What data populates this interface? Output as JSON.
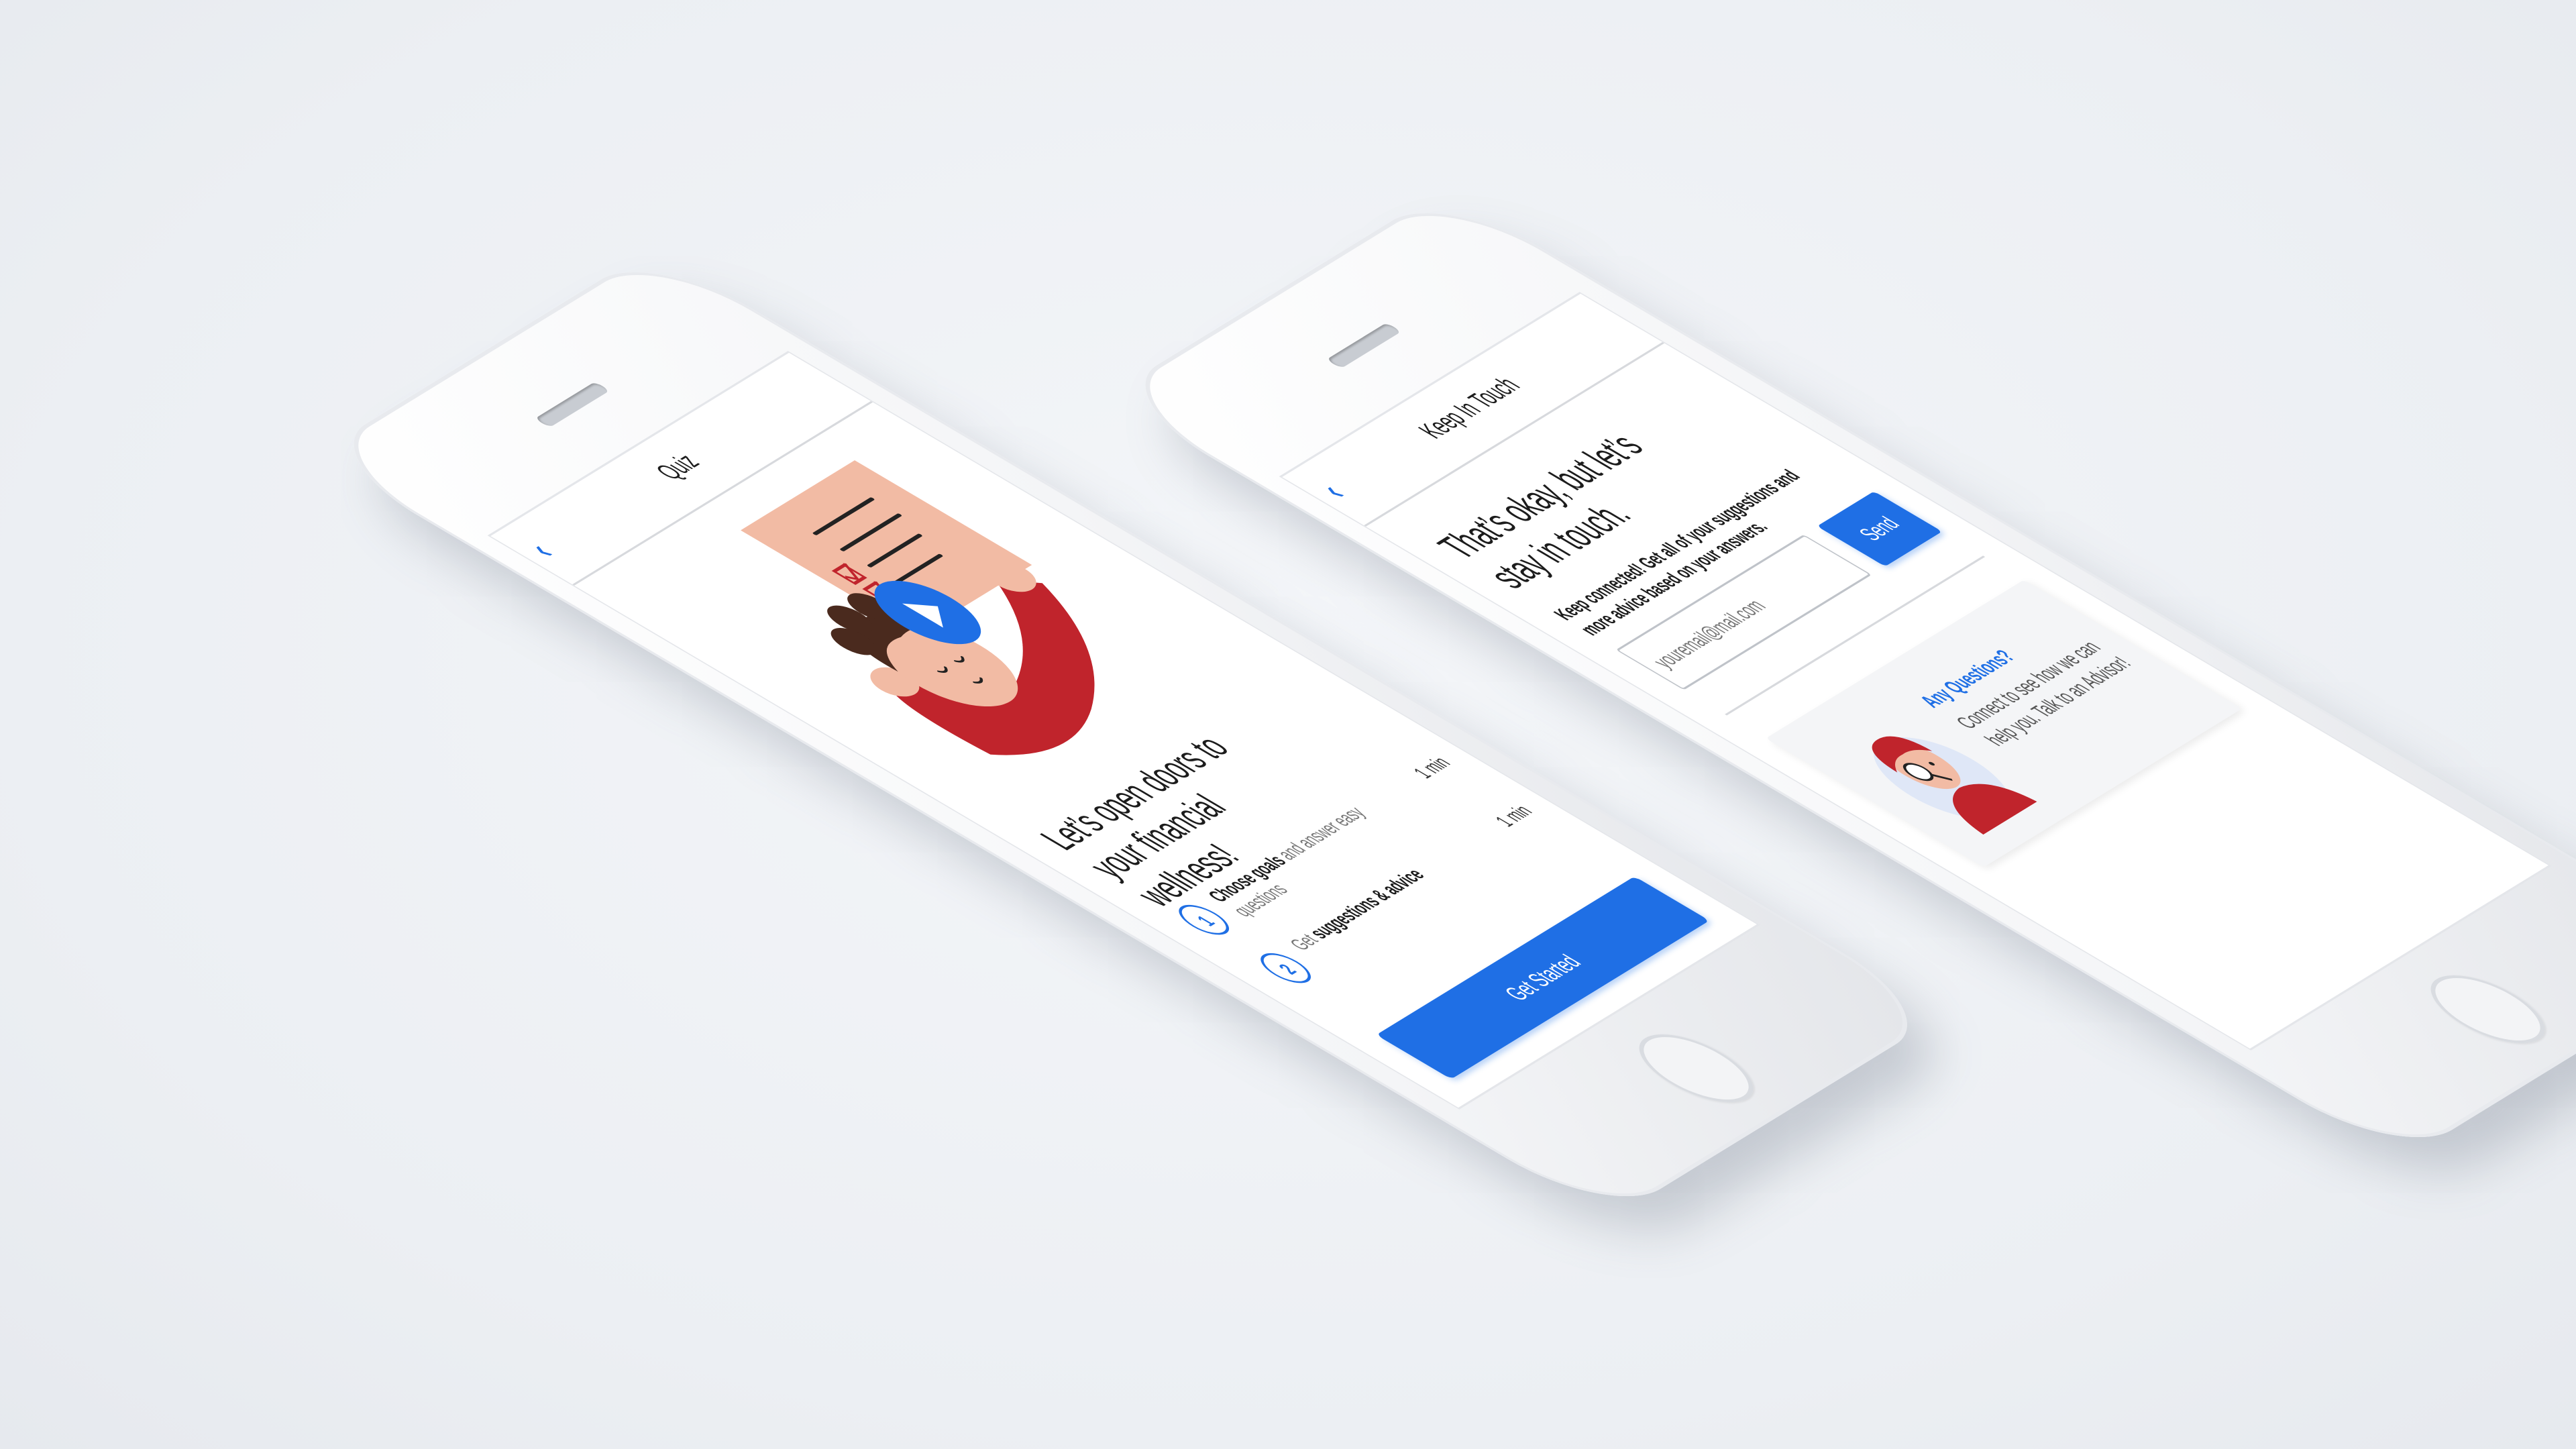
{
  "colors": {
    "accent": "#1f6fe5",
    "illustration_red": "#c0242c",
    "illustration_peach": "#f2bba4",
    "background": "#eef1f5"
  },
  "quiz_screen": {
    "title": "Quiz",
    "back_icon": "chevron-left-icon",
    "headline": "Let’s open doors to your financial wellness!",
    "play_icon": "play-icon",
    "steps": [
      {
        "number": "1",
        "bold": "Choose goals",
        "rest": " and answer easy questions",
        "time": "1 min"
      },
      {
        "number": "2",
        "lead": "Get ",
        "bold": "suggestions & advice",
        "time": "1 min"
      }
    ],
    "cta": "Get Started"
  },
  "keep_in_touch_screen": {
    "title": "Keep In Touch",
    "back_icon": "chevron-left-icon",
    "headline": "That’s okay, but let’s stay in touch.",
    "description": "Keep connected! Get all of your suggestions and more advice based on your answers.",
    "email_placeholder": "youremail@mail.com",
    "send_label": "Send",
    "advisor_card": {
      "question": "Any Questions?",
      "text": "Connect to see how we can help you. Talk to an Advisor!"
    }
  }
}
